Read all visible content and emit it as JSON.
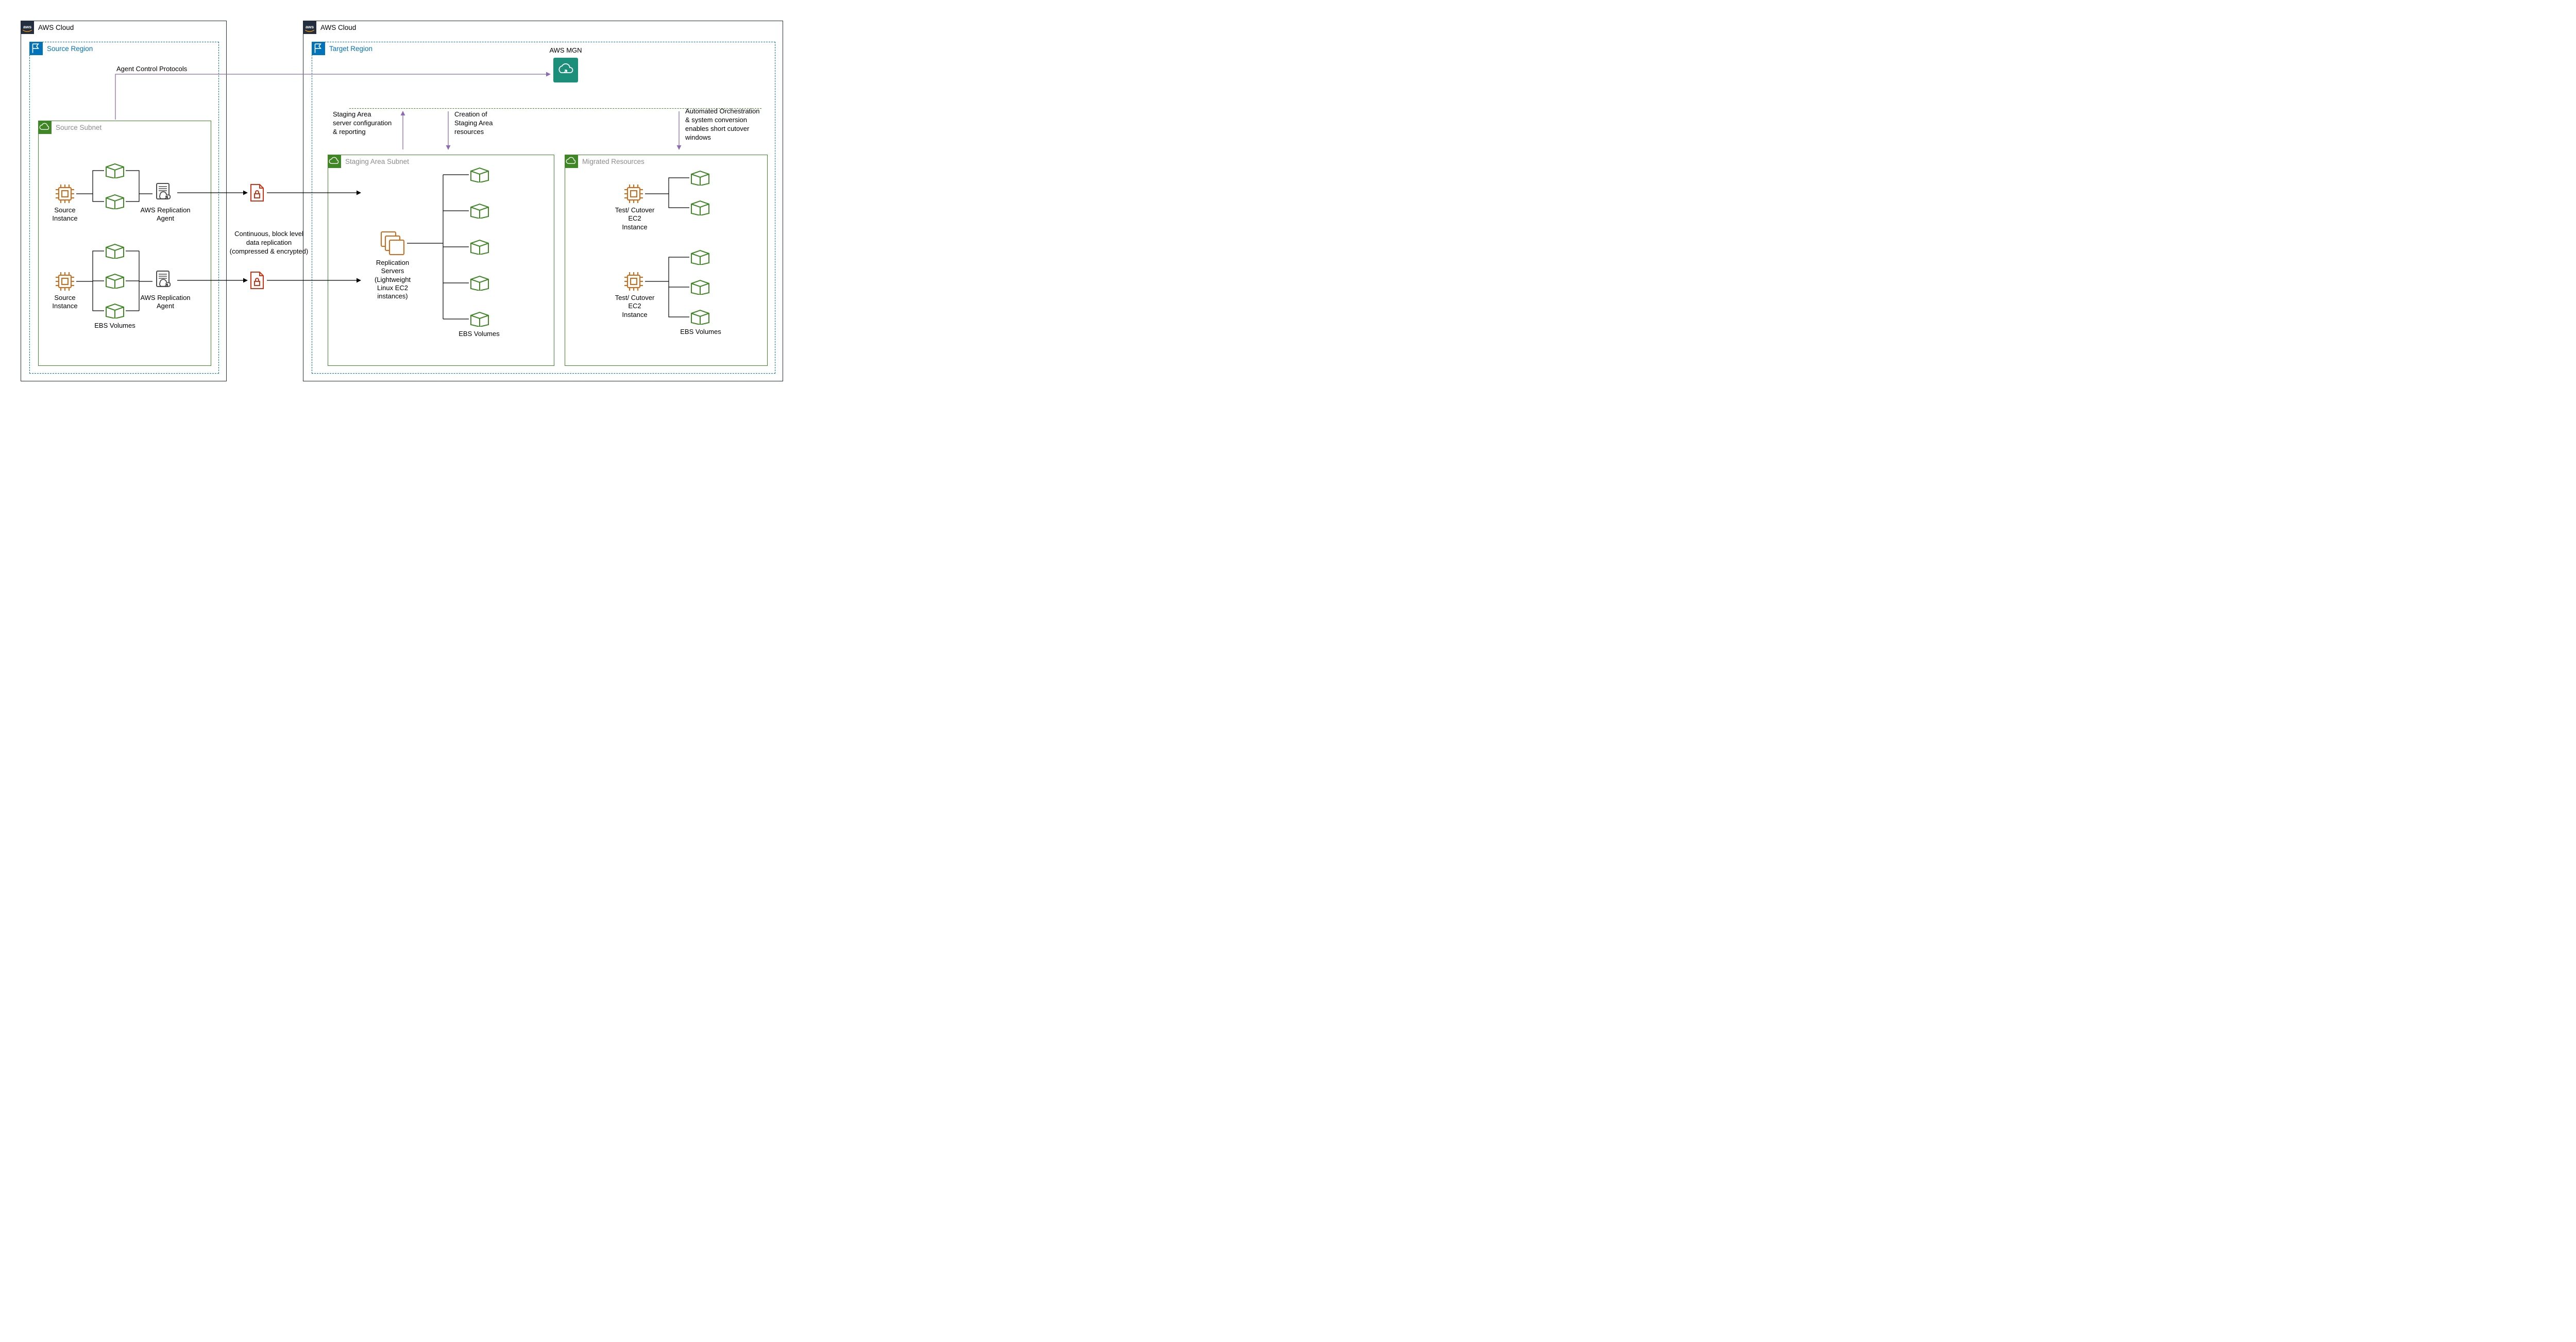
{
  "left_cloud": {
    "title": "AWS Cloud",
    "region": {
      "title": "Source Region",
      "subnet": {
        "title": "Source Subnet",
        "instance_label": "Source\nInstance",
        "agent_label": "AWS Replication\nAgent",
        "ebs_label": "EBS Volumes"
      }
    }
  },
  "right_cloud": {
    "title": "AWS Cloud",
    "region": {
      "title": "Target Region",
      "mgn_label": "AWS MGN",
      "staging_subnet": {
        "title": "Staging Area Subnet",
        "replication_servers_label": "Replication\nServers\n(Lightweight\nLinux EC2\ninstances)",
        "ebs_label": "EBS Volumes"
      },
      "migrated_subnet": {
        "title": "Migrated Resources",
        "instance_label": "Test/ Cutover\nEC2\nInstance",
        "ebs_label": "EBS Volumes"
      }
    }
  },
  "annotations": {
    "agent_control": "Agent Control Protocols",
    "replication": "Continuous, block level\ndata replication\n(compressed & encrypted)",
    "staging_config": "Staging Area\nserver configuration\n& reporting",
    "staging_creation": "Creation of\nStaging Area\nresources",
    "orchestration": "Automated Orchestration\n& system conversion\nenables short cutover\nwindows"
  },
  "colors": {
    "cloud_border": "#232f3e",
    "region_border": "#0073bb",
    "subnet_border": "#3f8624",
    "cpu_orange": "#d86613",
    "agent_grey": "#4d4d4d",
    "lock_red": "#d13212",
    "mgn_teal": "#1b8f7a",
    "purple_arrow": "#8c6bb1"
  }
}
